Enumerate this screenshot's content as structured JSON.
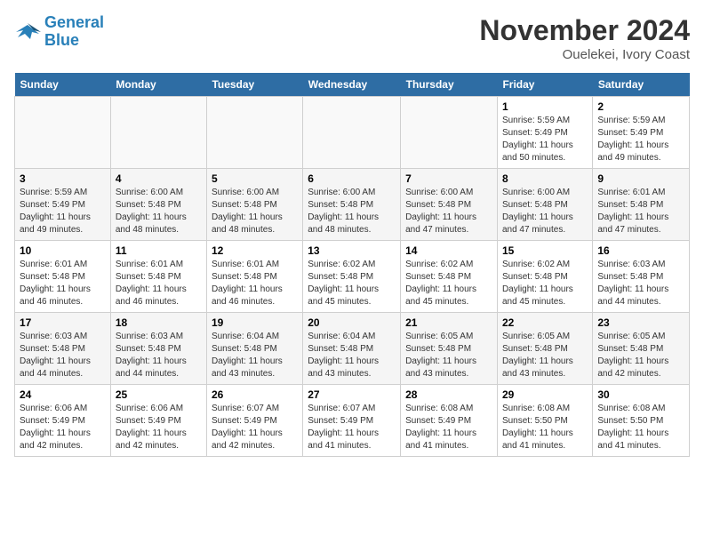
{
  "logo": {
    "line1": "General",
    "line2": "Blue"
  },
  "title": "November 2024",
  "location": "Ouelekei, Ivory Coast",
  "weekdays": [
    "Sunday",
    "Monday",
    "Tuesday",
    "Wednesday",
    "Thursday",
    "Friday",
    "Saturday"
  ],
  "weeks": [
    [
      {
        "day": "",
        "info": ""
      },
      {
        "day": "",
        "info": ""
      },
      {
        "day": "",
        "info": ""
      },
      {
        "day": "",
        "info": ""
      },
      {
        "day": "",
        "info": ""
      },
      {
        "day": "1",
        "info": "Sunrise: 5:59 AM\nSunset: 5:49 PM\nDaylight: 11 hours\nand 50 minutes."
      },
      {
        "day": "2",
        "info": "Sunrise: 5:59 AM\nSunset: 5:49 PM\nDaylight: 11 hours\nand 49 minutes."
      }
    ],
    [
      {
        "day": "3",
        "info": "Sunrise: 5:59 AM\nSunset: 5:49 PM\nDaylight: 11 hours\nand 49 minutes."
      },
      {
        "day": "4",
        "info": "Sunrise: 6:00 AM\nSunset: 5:48 PM\nDaylight: 11 hours\nand 48 minutes."
      },
      {
        "day": "5",
        "info": "Sunrise: 6:00 AM\nSunset: 5:48 PM\nDaylight: 11 hours\nand 48 minutes."
      },
      {
        "day": "6",
        "info": "Sunrise: 6:00 AM\nSunset: 5:48 PM\nDaylight: 11 hours\nand 48 minutes."
      },
      {
        "day": "7",
        "info": "Sunrise: 6:00 AM\nSunset: 5:48 PM\nDaylight: 11 hours\nand 47 minutes."
      },
      {
        "day": "8",
        "info": "Sunrise: 6:00 AM\nSunset: 5:48 PM\nDaylight: 11 hours\nand 47 minutes."
      },
      {
        "day": "9",
        "info": "Sunrise: 6:01 AM\nSunset: 5:48 PM\nDaylight: 11 hours\nand 47 minutes."
      }
    ],
    [
      {
        "day": "10",
        "info": "Sunrise: 6:01 AM\nSunset: 5:48 PM\nDaylight: 11 hours\nand 46 minutes."
      },
      {
        "day": "11",
        "info": "Sunrise: 6:01 AM\nSunset: 5:48 PM\nDaylight: 11 hours\nand 46 minutes."
      },
      {
        "day": "12",
        "info": "Sunrise: 6:01 AM\nSunset: 5:48 PM\nDaylight: 11 hours\nand 46 minutes."
      },
      {
        "day": "13",
        "info": "Sunrise: 6:02 AM\nSunset: 5:48 PM\nDaylight: 11 hours\nand 45 minutes."
      },
      {
        "day": "14",
        "info": "Sunrise: 6:02 AM\nSunset: 5:48 PM\nDaylight: 11 hours\nand 45 minutes."
      },
      {
        "day": "15",
        "info": "Sunrise: 6:02 AM\nSunset: 5:48 PM\nDaylight: 11 hours\nand 45 minutes."
      },
      {
        "day": "16",
        "info": "Sunrise: 6:03 AM\nSunset: 5:48 PM\nDaylight: 11 hours\nand 44 minutes."
      }
    ],
    [
      {
        "day": "17",
        "info": "Sunrise: 6:03 AM\nSunset: 5:48 PM\nDaylight: 11 hours\nand 44 minutes."
      },
      {
        "day": "18",
        "info": "Sunrise: 6:03 AM\nSunset: 5:48 PM\nDaylight: 11 hours\nand 44 minutes."
      },
      {
        "day": "19",
        "info": "Sunrise: 6:04 AM\nSunset: 5:48 PM\nDaylight: 11 hours\nand 43 minutes."
      },
      {
        "day": "20",
        "info": "Sunrise: 6:04 AM\nSunset: 5:48 PM\nDaylight: 11 hours\nand 43 minutes."
      },
      {
        "day": "21",
        "info": "Sunrise: 6:05 AM\nSunset: 5:48 PM\nDaylight: 11 hours\nand 43 minutes."
      },
      {
        "day": "22",
        "info": "Sunrise: 6:05 AM\nSunset: 5:48 PM\nDaylight: 11 hours\nand 43 minutes."
      },
      {
        "day": "23",
        "info": "Sunrise: 6:05 AM\nSunset: 5:48 PM\nDaylight: 11 hours\nand 42 minutes."
      }
    ],
    [
      {
        "day": "24",
        "info": "Sunrise: 6:06 AM\nSunset: 5:49 PM\nDaylight: 11 hours\nand 42 minutes."
      },
      {
        "day": "25",
        "info": "Sunrise: 6:06 AM\nSunset: 5:49 PM\nDaylight: 11 hours\nand 42 minutes."
      },
      {
        "day": "26",
        "info": "Sunrise: 6:07 AM\nSunset: 5:49 PM\nDaylight: 11 hours\nand 42 minutes."
      },
      {
        "day": "27",
        "info": "Sunrise: 6:07 AM\nSunset: 5:49 PM\nDaylight: 11 hours\nand 41 minutes."
      },
      {
        "day": "28",
        "info": "Sunrise: 6:08 AM\nSunset: 5:49 PM\nDaylight: 11 hours\nand 41 minutes."
      },
      {
        "day": "29",
        "info": "Sunrise: 6:08 AM\nSunset: 5:50 PM\nDaylight: 11 hours\nand 41 minutes."
      },
      {
        "day": "30",
        "info": "Sunrise: 6:08 AM\nSunset: 5:50 PM\nDaylight: 11 hours\nand 41 minutes."
      }
    ]
  ]
}
